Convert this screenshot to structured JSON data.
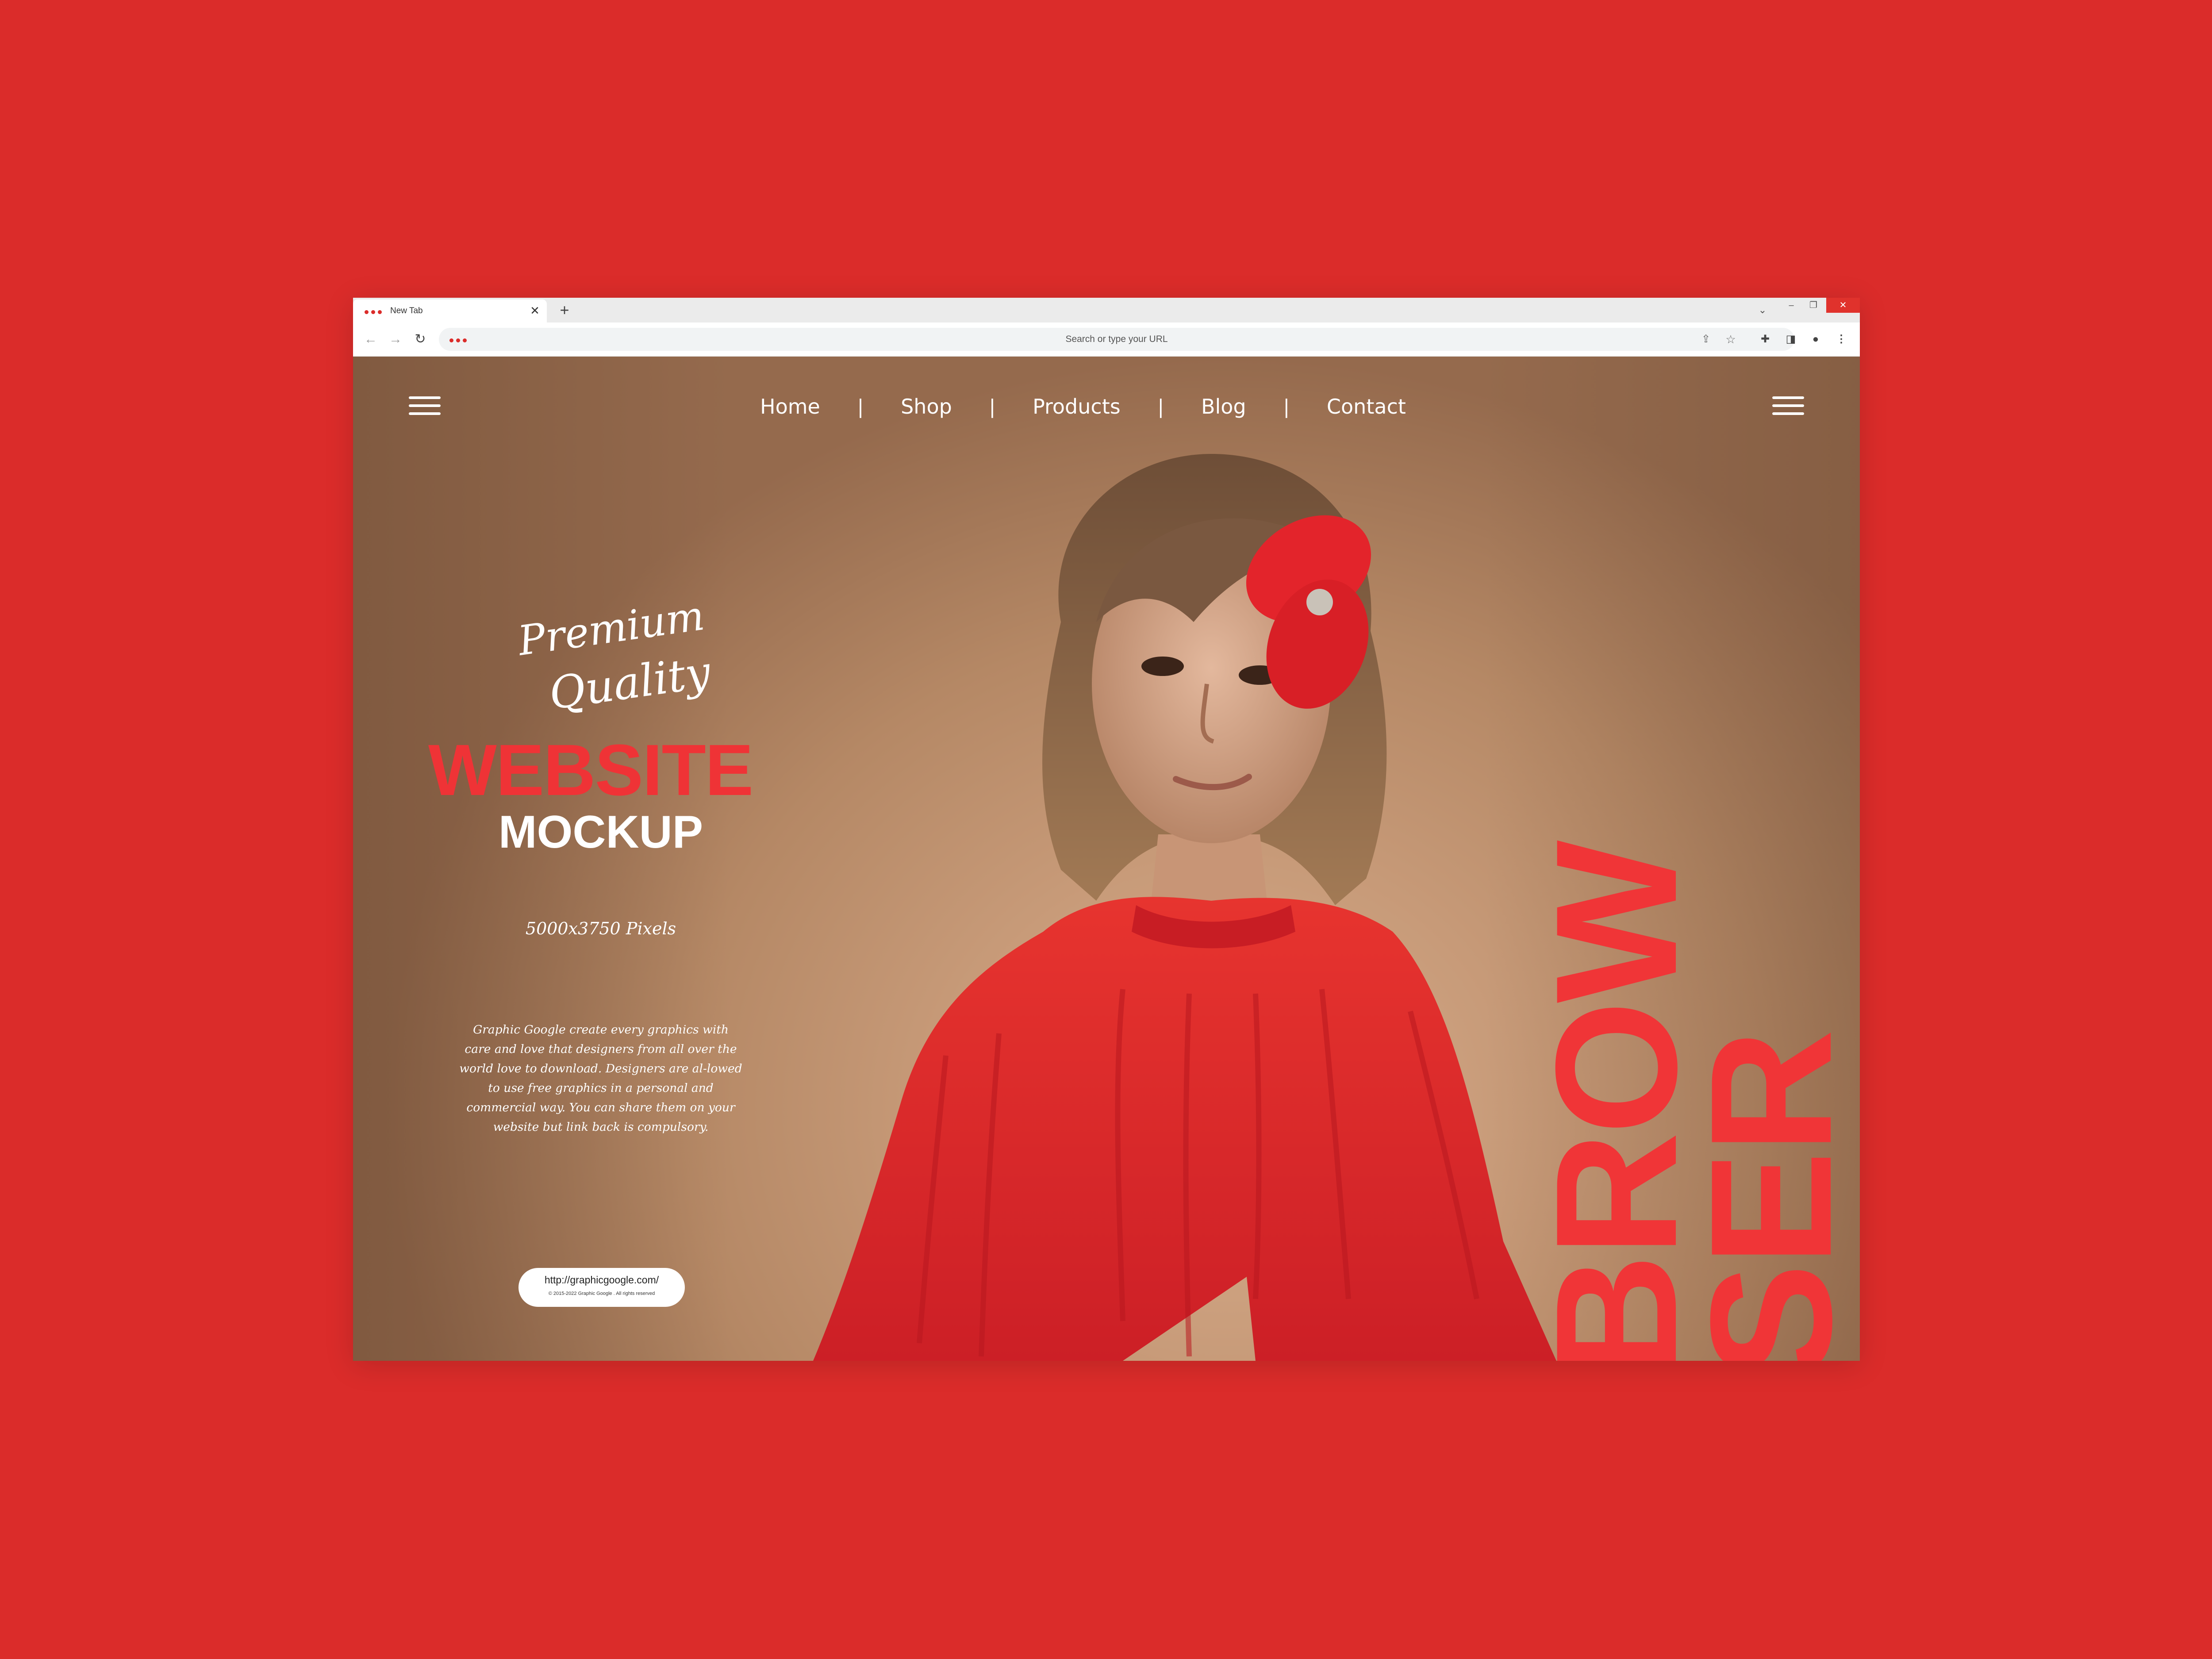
{
  "browser": {
    "tab_title": "New Tab",
    "tab_close": "✕",
    "new_tab": "+",
    "address_placeholder": "Search or type your URL",
    "window_controls": {
      "minimize": "–",
      "maximize": "❐",
      "close": "✕"
    }
  },
  "site": {
    "nav": [
      "Home",
      "Shop",
      "Products",
      "Blog",
      "Contact"
    ],
    "nav_separator": "|",
    "script_line1": "Premium",
    "script_line2": "Quality",
    "heading_red": "WEBSITE",
    "heading_white": "MOCKUP",
    "dimensions": "5000x3750 Pixels",
    "description": "Graphic Google create every graphics with care and love that designers from all over the world love to download. Designers are al-lowed to use free graphics in a personal and commercial way. You can share them on your website but link back is compulsory.",
    "link_url": "http://graphicgoogle.com/",
    "link_copyright": "© 2015-2022 Graphic Google . All rights reserved",
    "vertical_word_part1": "BROW",
    "vertical_word_part2": "SER"
  },
  "colors": {
    "background": "#db2c2a",
    "accent_red": "#ef3336",
    "page_bg": "#c79a78",
    "sweater": "#e0262b"
  },
  "icons": [
    "menu-icon",
    "back-icon",
    "forward-icon",
    "reload-icon",
    "share-icon",
    "star-icon",
    "extensions-icon",
    "side-panel-icon",
    "profile-icon",
    "kebab-menu-icon",
    "tab-search-icon"
  ]
}
